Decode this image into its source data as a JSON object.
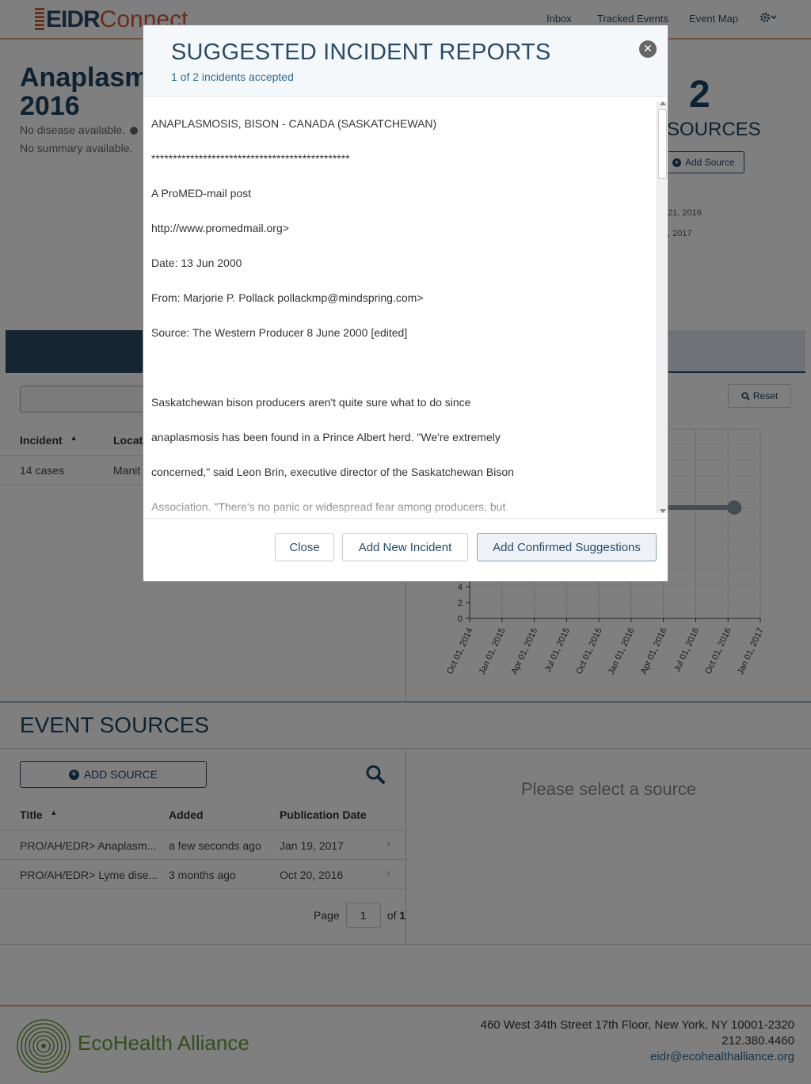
{
  "header": {
    "logo_eidr": "EIDR",
    "logo_connect": "Connect",
    "nav": [
      {
        "label": "Inbox"
      },
      {
        "label": "Tracked Events"
      },
      {
        "label": "Event Map"
      }
    ]
  },
  "event": {
    "title_line1": "Anaplasm",
    "title_line2": "2016",
    "disease": "No disease available.",
    "summary": "No summary available.",
    "sources_count": "2",
    "sources_label": "SOURCES",
    "add_source_label": "Add Source",
    "date_1": "21, 2016",
    "date_2": ", 2017"
  },
  "incidents": {
    "headers": {
      "incident": "Incident",
      "location": "Locat"
    },
    "rows": [
      {
        "incident": "14 cases",
        "location": "Manit"
      }
    ],
    "reset_label": "Reset"
  },
  "chart_data": {
    "type": "line",
    "x_tick_labels": [
      "Oct 01, 2014",
      "Jan 01, 2015",
      "Apr 01, 2015",
      "Jul 01, 2015",
      "Oct 01, 2015",
      "Jan 01, 2016",
      "Apr 01, 2016",
      "Jul 01, 2016",
      "Oct 01, 2016",
      "Jan 01, 2017"
    ],
    "y_tick_labels": [
      "0",
      "2",
      "4"
    ],
    "series": [
      {
        "x": [
          "Oct 01, 2016"
        ],
        "y": [
          14
        ]
      }
    ]
  },
  "event_sources": {
    "title": "EVENT SOURCES",
    "add_label": "ADD SOURCE",
    "headers": {
      "title": "Title",
      "added": "Added",
      "pubdate": "Publication Date"
    },
    "rows": [
      {
        "title": "PRO/AH/EDR> Anaplasm...",
        "added": "a few seconds ago",
        "pubdate": "Jan 19, 2017"
      },
      {
        "title": "PRO/AH/EDR> Lyme dise...",
        "added": "3 months ago",
        "pubdate": "Oct 20, 2016"
      }
    ],
    "pager": {
      "page_label": "Page",
      "page": "1",
      "of_label": "of",
      "total": "1"
    },
    "empty_detail": "Please select a source"
  },
  "footer": {
    "org_name": "EcoHealth Alliance",
    "address": "460 West 34th Street 17th Floor, New York, NY 10001-2320",
    "phone": "212.380.4460",
    "email": "eidr@ecohealthalliance.org"
  },
  "modal": {
    "title": "SUGGESTED INCIDENT REPORTS",
    "subtitle": "1 of 2 incidents accepted",
    "report_lines": [
      "ANAPLASMOSIS, BISON - CANADA (SASKATCHEWAN)",
      "**********************************************",
      "A ProMED-mail post",
      "http://www.promedmail.org>",
      "Date: 13 Jun 2000",
      "From: Marjorie P. Pollack pollackmp@mindspring.com>",
      "Source: The Western Producer 8 June 2000 [edited]",
      "Saskatchewan bison producers aren't quite sure what to do since",
      "anaplasmosis has been found in a Prince Albert herd. \"We're extremely",
      "concerned,\" said Leon Brin, executive director of the Saskatchewan Bison",
      "Association. \"There's no panic or widespread fear among producers, but"
    ],
    "buttons": {
      "close": "Close",
      "add_new": "Add New Incident",
      "add_confirmed": "Add Confirmed Suggestions"
    }
  },
  "colors": {
    "brand_navy": "#2a4b68",
    "brand_orange": "#d25a3a",
    "eco_green": "#6a9a3a",
    "link_blue": "#2a6a99"
  }
}
